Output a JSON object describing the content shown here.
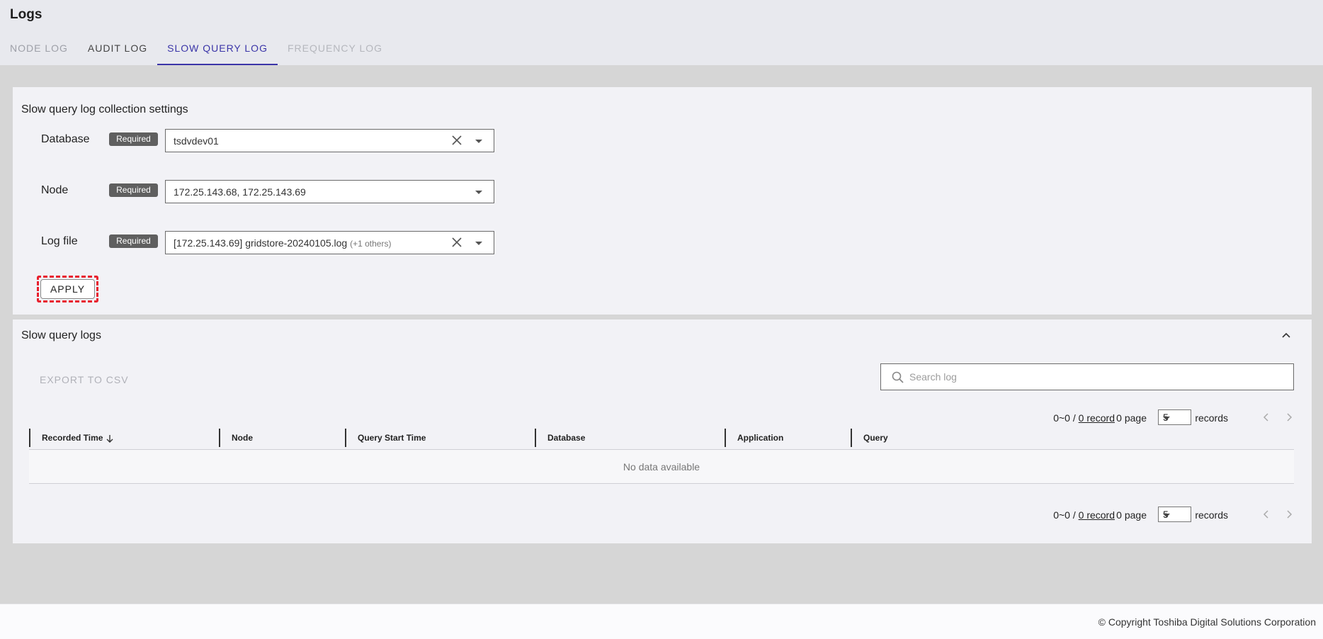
{
  "page": {
    "title": "Logs"
  },
  "tabs": [
    {
      "label": "NODE LOG",
      "state": "inactive"
    },
    {
      "label": "AUDIT LOG",
      "state": "inactive"
    },
    {
      "label": "SLOW QUERY LOG",
      "state": "active"
    },
    {
      "label": "FREQUENCY LOG",
      "state": "disabled"
    }
  ],
  "settings": {
    "title": "Slow query log collection settings",
    "required_label": "Required",
    "fields": {
      "database": {
        "label": "Database",
        "value": "tsdvdev01"
      },
      "node": {
        "label": "Node",
        "value": "172.25.143.68, 172.25.143.69"
      },
      "log_file": {
        "label": "Log file",
        "value": "[172.25.143.69] gridstore-20240105.log",
        "extra": "(+1 others)"
      }
    },
    "apply_label": "APPLY"
  },
  "logs": {
    "title": "Slow query logs",
    "export_label": "EXPORT TO CSV",
    "search_placeholder": "Search log",
    "pager": {
      "range": "0~0 / ",
      "record_link": "0 record",
      "page": "0 page",
      "per_page": "5",
      "records_label": "records"
    },
    "columns": [
      "Recorded Time",
      "Node",
      "Query Start Time",
      "Database",
      "Application",
      "Query"
    ],
    "empty_text": "No data available"
  },
  "footer": {
    "copyright": "© Copyright Toshiba Digital Solutions Corporation"
  },
  "colors": {
    "accent": "#3b35a8",
    "highlight": "#e8202e",
    "badge": "#5f5f5f"
  }
}
